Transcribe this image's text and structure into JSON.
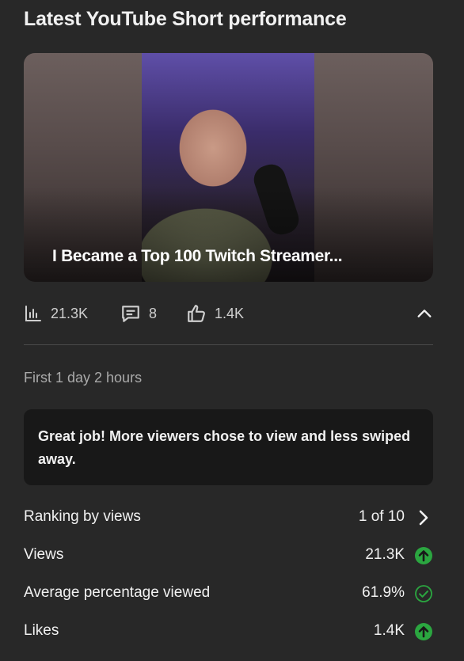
{
  "header": {
    "title": "Latest YouTube Short performance"
  },
  "short": {
    "caption": "I Became a Top 100 Twitch Streamer..."
  },
  "stats": {
    "views": "21.3K",
    "comments": "8",
    "likes": "1.4K"
  },
  "period": "First 1 day 2 hours",
  "note": "Great job! More viewers chose to view and less swiped away.",
  "metrics": [
    {
      "label": "Ranking by views",
      "value": "1 of 10",
      "icon": "chevron-right-icon"
    },
    {
      "label": "Views",
      "value": "21.3K",
      "icon": "arrow-up-circle-icon"
    },
    {
      "label": "Average percentage viewed",
      "value": "61.9%",
      "icon": "check-circle-icon"
    },
    {
      "label": "Likes",
      "value": "1.4K",
      "icon": "arrow-up-circle-icon"
    }
  ],
  "colors": {
    "background": "#282828",
    "card": "#181818",
    "positive": "#2ba640"
  }
}
